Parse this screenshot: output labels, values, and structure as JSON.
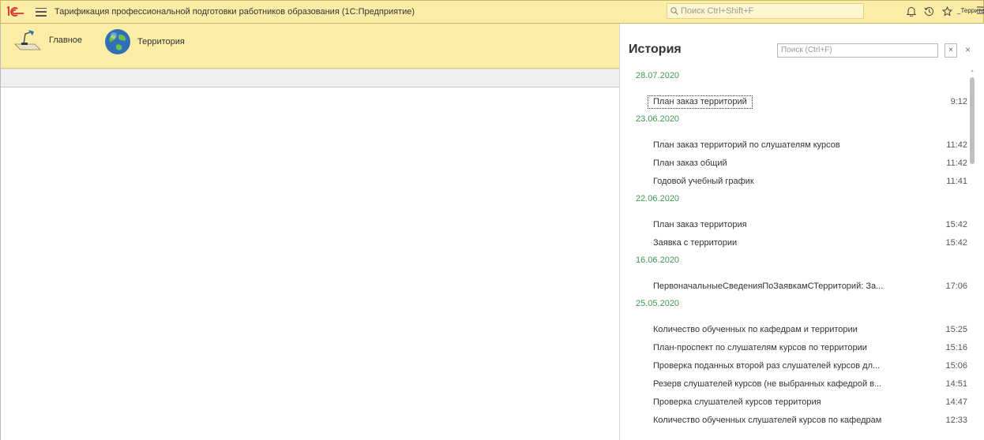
{
  "titlebar": {
    "app_title": "Тарификация профессиональной подготовки работников образования  (1С:Предприятие)",
    "search_placeholder": "Поиск Ctrl+Shift+F",
    "user": "_Территория"
  },
  "sections": [
    {
      "label": "Главное"
    },
    {
      "label": "Территория"
    }
  ],
  "history": {
    "title": "История",
    "search_placeholder": "Поиск (Ctrl+F)",
    "clear": "×",
    "close": "×",
    "groups": [
      {
        "date": "28.07.2020",
        "items": [
          {
            "name": "План заказ территорий",
            "time": "9:12"
          }
        ]
      },
      {
        "date": "23.06.2020",
        "items": [
          {
            "name": "План заказ территорий по слушателям курсов",
            "time": "11:42"
          },
          {
            "name": "План заказ общий",
            "time": "11:42"
          },
          {
            "name": "Годовой учебный график",
            "time": "11:41"
          }
        ]
      },
      {
        "date": "22.06.2020",
        "items": [
          {
            "name": "План заказ территория",
            "time": "15:42"
          },
          {
            "name": "Заявка с территории",
            "time": "15:42"
          }
        ]
      },
      {
        "date": "16.06.2020",
        "items": [
          {
            "name": "ПервоначальныеСведенияПоЗаявкамСТерриторий: За...",
            "time": "17:06"
          }
        ]
      },
      {
        "date": "25.05.2020",
        "items": [
          {
            "name": "Количество обученных по кафедрам и территории",
            "time": "15:25"
          },
          {
            "name": "План-проспект по слушателям курсов по территории",
            "time": "15:16"
          },
          {
            "name": "Проверка поданных второй раз слушателей курсов дл...",
            "time": "15:06"
          },
          {
            "name": "Резерв слушателей курсов (не выбранных кафедрой в...",
            "time": "14:51"
          },
          {
            "name": "Проверка слушателей курсов территория",
            "time": "14:47"
          },
          {
            "name": "Количество обученных слушателей курсов по кафедрам",
            "time": "12:33"
          }
        ]
      }
    ]
  }
}
